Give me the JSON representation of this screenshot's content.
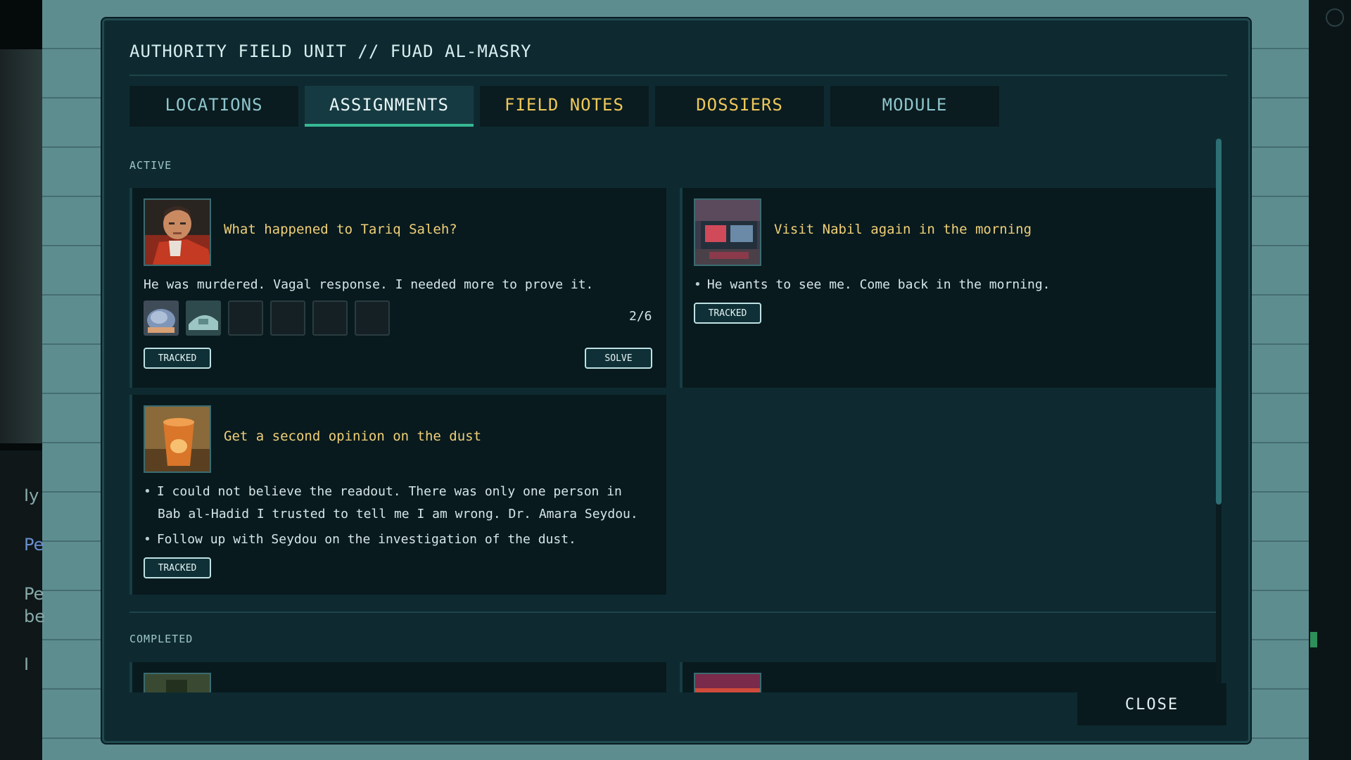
{
  "window": {
    "title": "AUTHORITY FIELD UNIT // FUAD AL-MASRY"
  },
  "tabs": [
    {
      "label": "LOCATIONS",
      "state": "dim"
    },
    {
      "label": "ASSIGNMENTS",
      "state": "active"
    },
    {
      "label": "FIELD NOTES",
      "state": "gold"
    },
    {
      "label": "DOSSIERS",
      "state": "gold"
    },
    {
      "label": "MODULE",
      "state": "dim"
    }
  ],
  "sections": {
    "active": "ACTIVE",
    "completed": "COMPLETED"
  },
  "assignments": [
    {
      "title": "What happened to Tariq Saleh?",
      "text": "He was murdered. Vagal response. I needed more to prove it.",
      "progress": "2/6",
      "tracked_label": "TRACKED",
      "solve_label": "SOLVE",
      "portrait": "injured-man-portrait"
    },
    {
      "title": "Visit Nabil again in the morning",
      "bullets": [
        "He wants to see me. Come back in the morning."
      ],
      "tracked_label": "TRACKED",
      "portrait": "street-shop-portrait"
    },
    {
      "title": "Get a second opinion on the dust",
      "bullets": [
        "I could not believe the readout. There was only one person in Bab al-Hadid I trusted to tell me I am wrong. Dr. Amara Seydou.",
        "Follow up with Seydou on the investigation of the dust."
      ],
      "tracked_label": "TRACKED",
      "portrait": "orange-glass-portrait"
    }
  ],
  "clue_slots": {
    "filled": 2,
    "total": 6
  },
  "close_label": "CLOSE",
  "colors": {
    "accent": "#36b894",
    "gold": "#efc85a",
    "panel": "#0e2a30"
  },
  "background_text": [
    "Iy",
    "Pe",
    "Pe",
    "be",
    "I"
  ]
}
